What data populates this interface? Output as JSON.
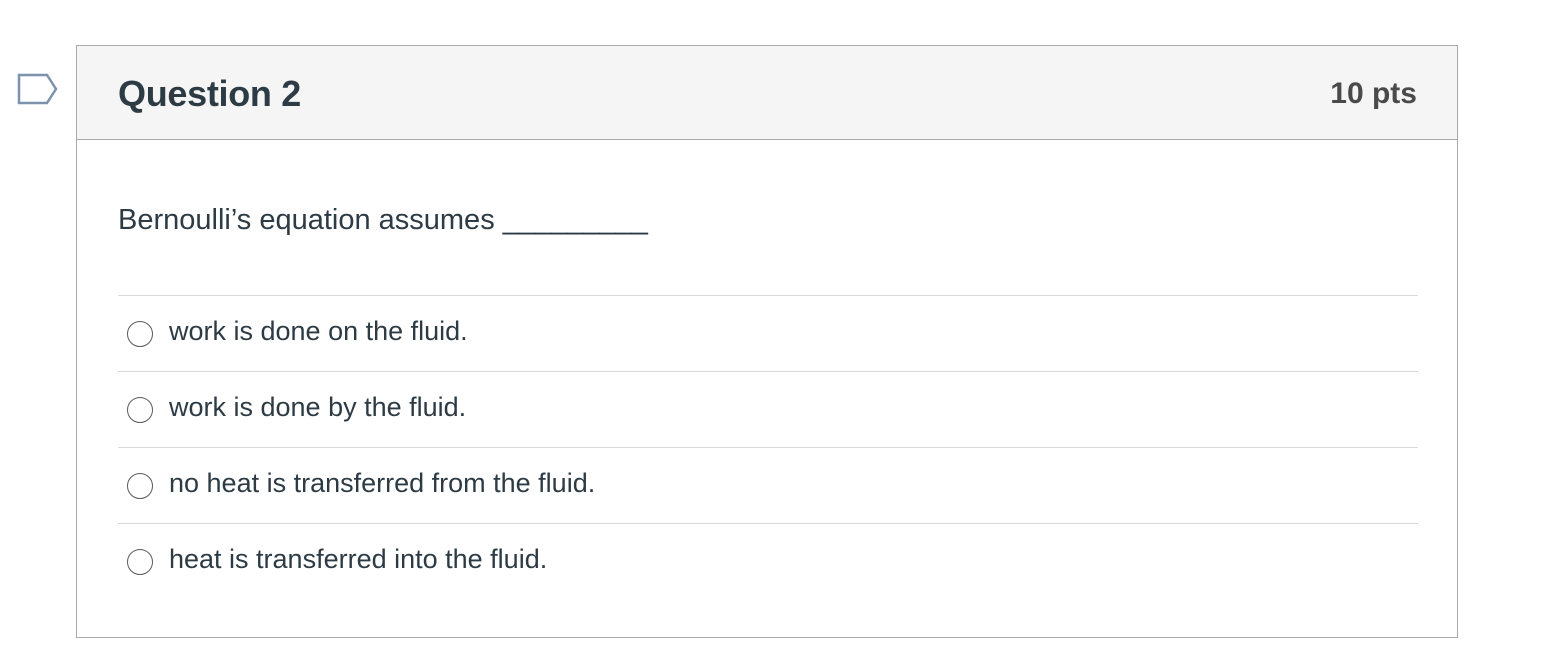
{
  "question": {
    "title": "Question 2",
    "points": "10 pts",
    "text": "Bernoulli’s equation assumes _________",
    "flag_icon": "bookmark-flag-icon",
    "answers": [
      {
        "label": "work is done on the fluid."
      },
      {
        "label": "work is done by the fluid."
      },
      {
        "label": "no heat is transferred from the fluid."
      },
      {
        "label": "heat is transferred into the fluid."
      }
    ]
  },
  "colors": {
    "header_bg": "#f5f5f5",
    "border": "#a9a9a9",
    "text": "#2d3b45",
    "flag_stroke": "#7d93ad"
  }
}
